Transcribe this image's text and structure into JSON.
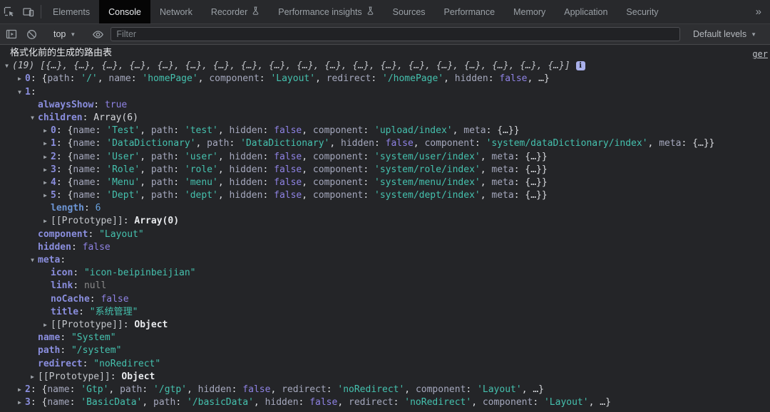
{
  "devtools": {
    "tabs": [
      {
        "label": "Elements",
        "active": false,
        "flask": false
      },
      {
        "label": "Console",
        "active": true,
        "flask": false
      },
      {
        "label": "Network",
        "active": false,
        "flask": false
      },
      {
        "label": "Recorder",
        "active": false,
        "flask": true
      },
      {
        "label": "Performance insights",
        "active": false,
        "flask": true
      },
      {
        "label": "Sources",
        "active": false,
        "flask": false
      },
      {
        "label": "Performance",
        "active": false,
        "flask": false
      },
      {
        "label": "Memory",
        "active": false,
        "flask": false
      },
      {
        "label": "Application",
        "active": false,
        "flask": false
      },
      {
        "label": "Security",
        "active": false,
        "flask": false
      }
    ],
    "more_tabs_glyph": "»"
  },
  "console_toolbar": {
    "context": "top",
    "chevron_glyph": "▼",
    "filter_placeholder": "Filter",
    "levels_label": "Default levels"
  },
  "console": {
    "source_link": "ger",
    "colors": {
      "key": "#8a8ede",
      "string": "#45c1ae",
      "boolean": "#8e82e3",
      "number": "#68a2e0",
      "null": "#8b8b8b",
      "preview": "#c0c3c8",
      "background": "#242528",
      "active_tab_bg": "#050505",
      "info_badge_bg": "#a9b0ea"
    },
    "rows": [
      {
        "lvl": "msg",
        "segs": [
          [
            "m",
            "格式化前的生成的路由表"
          ]
        ]
      },
      {
        "lvl": 0,
        "arrow": "v",
        "info": true,
        "segs": [
          [
            "i",
            "(19) [{…}, {…}, {…}, {…}, {…}, {…}, {…}, {…}, {…}, {…}, {…}, {…}, {…}, {…}, {…}, {…}, {…}, {…}, {…}]"
          ]
        ]
      },
      {
        "lvl": 1,
        "arrow": ">",
        "segs": [
          [
            "k",
            "0"
          ],
          [
            "t",
            ": {"
          ],
          [
            "p",
            "path"
          ],
          [
            "t",
            ": "
          ],
          [
            "s",
            "'/'"
          ],
          [
            "t",
            ", "
          ],
          [
            "p",
            "name"
          ],
          [
            "t",
            ": "
          ],
          [
            "s",
            "'homePage'"
          ],
          [
            "t",
            ", "
          ],
          [
            "p",
            "component"
          ],
          [
            "t",
            ": "
          ],
          [
            "s",
            "'Layout'"
          ],
          [
            "t",
            ", "
          ],
          [
            "p",
            "redirect"
          ],
          [
            "t",
            ": "
          ],
          [
            "s",
            "'/homePage'"
          ],
          [
            "t",
            ", "
          ],
          [
            "p",
            "hidden"
          ],
          [
            "t",
            ": "
          ],
          [
            "b",
            "false"
          ],
          [
            "t",
            ", …}"
          ]
        ]
      },
      {
        "lvl": 1,
        "arrow": "v",
        "segs": [
          [
            "k",
            "1"
          ],
          [
            "t",
            ":"
          ]
        ]
      },
      {
        "lvl": 2,
        "segs": [
          [
            "k",
            "alwaysShow"
          ],
          [
            "t",
            ": "
          ],
          [
            "b",
            "true"
          ]
        ]
      },
      {
        "lvl": 2,
        "arrow": "v",
        "segs": [
          [
            "k",
            "children"
          ],
          [
            "t",
            ": "
          ],
          [
            "t",
            "Array(6)"
          ]
        ]
      },
      {
        "lvl": 3,
        "arrow": ">",
        "segs": [
          [
            "k",
            "0"
          ],
          [
            "t",
            ": {"
          ],
          [
            "p",
            "name"
          ],
          [
            "t",
            ": "
          ],
          [
            "s",
            "'Test'"
          ],
          [
            "t",
            ", "
          ],
          [
            "p",
            "path"
          ],
          [
            "t",
            ": "
          ],
          [
            "s",
            "'test'"
          ],
          [
            "t",
            ", "
          ],
          [
            "p",
            "hidden"
          ],
          [
            "t",
            ": "
          ],
          [
            "b",
            "false"
          ],
          [
            "t",
            ", "
          ],
          [
            "p",
            "component"
          ],
          [
            "t",
            ": "
          ],
          [
            "s",
            "'upload/index'"
          ],
          [
            "t",
            ", "
          ],
          [
            "p",
            "meta"
          ],
          [
            "t",
            ": {…}}"
          ]
        ]
      },
      {
        "lvl": 3,
        "arrow": ">",
        "segs": [
          [
            "k",
            "1"
          ],
          [
            "t",
            ": {"
          ],
          [
            "p",
            "name"
          ],
          [
            "t",
            ": "
          ],
          [
            "s",
            "'DataDictionary'"
          ],
          [
            "t",
            ", "
          ],
          [
            "p",
            "path"
          ],
          [
            "t",
            ": "
          ],
          [
            "s",
            "'DataDictionary'"
          ],
          [
            "t",
            ", "
          ],
          [
            "p",
            "hidden"
          ],
          [
            "t",
            ": "
          ],
          [
            "b",
            "false"
          ],
          [
            "t",
            ", "
          ],
          [
            "p",
            "component"
          ],
          [
            "t",
            ": "
          ],
          [
            "s",
            "'system/dataDictionary/index'"
          ],
          [
            "t",
            ", "
          ],
          [
            "p",
            "meta"
          ],
          [
            "t",
            ": {…}}"
          ]
        ]
      },
      {
        "lvl": 3,
        "arrow": ">",
        "segs": [
          [
            "k",
            "2"
          ],
          [
            "t",
            ": {"
          ],
          [
            "p",
            "name"
          ],
          [
            "t",
            ": "
          ],
          [
            "s",
            "'User'"
          ],
          [
            "t",
            ", "
          ],
          [
            "p",
            "path"
          ],
          [
            "t",
            ": "
          ],
          [
            "s",
            "'user'"
          ],
          [
            "t",
            ", "
          ],
          [
            "p",
            "hidden"
          ],
          [
            "t",
            ": "
          ],
          [
            "b",
            "false"
          ],
          [
            "t",
            ", "
          ],
          [
            "p",
            "component"
          ],
          [
            "t",
            ": "
          ],
          [
            "s",
            "'system/user/index'"
          ],
          [
            "t",
            ", "
          ],
          [
            "p",
            "meta"
          ],
          [
            "t",
            ": {…}}"
          ]
        ]
      },
      {
        "lvl": 3,
        "arrow": ">",
        "segs": [
          [
            "k",
            "3"
          ],
          [
            "t",
            ": {"
          ],
          [
            "p",
            "name"
          ],
          [
            "t",
            ": "
          ],
          [
            "s",
            "'Role'"
          ],
          [
            "t",
            ", "
          ],
          [
            "p",
            "path"
          ],
          [
            "t",
            ": "
          ],
          [
            "s",
            "'role'"
          ],
          [
            "t",
            ", "
          ],
          [
            "p",
            "hidden"
          ],
          [
            "t",
            ": "
          ],
          [
            "b",
            "false"
          ],
          [
            "t",
            ", "
          ],
          [
            "p",
            "component"
          ],
          [
            "t",
            ": "
          ],
          [
            "s",
            "'system/role/index'"
          ],
          [
            "t",
            ", "
          ],
          [
            "p",
            "meta"
          ],
          [
            "t",
            ": {…}}"
          ]
        ]
      },
      {
        "lvl": 3,
        "arrow": ">",
        "segs": [
          [
            "k",
            "4"
          ],
          [
            "t",
            ": {"
          ],
          [
            "p",
            "name"
          ],
          [
            "t",
            ": "
          ],
          [
            "s",
            "'Menu'"
          ],
          [
            "t",
            ", "
          ],
          [
            "p",
            "path"
          ],
          [
            "t",
            ": "
          ],
          [
            "s",
            "'menu'"
          ],
          [
            "t",
            ", "
          ],
          [
            "p",
            "hidden"
          ],
          [
            "t",
            ": "
          ],
          [
            "b",
            "false"
          ],
          [
            "t",
            ", "
          ],
          [
            "p",
            "component"
          ],
          [
            "t",
            ": "
          ],
          [
            "s",
            "'system/menu/index'"
          ],
          [
            "t",
            ", "
          ],
          [
            "p",
            "meta"
          ],
          [
            "t",
            ": {…}}"
          ]
        ]
      },
      {
        "lvl": 3,
        "arrow": ">",
        "segs": [
          [
            "k",
            "5"
          ],
          [
            "t",
            ": {"
          ],
          [
            "p",
            "name"
          ],
          [
            "t",
            ": "
          ],
          [
            "s",
            "'Dept'"
          ],
          [
            "t",
            ", "
          ],
          [
            "p",
            "path"
          ],
          [
            "t",
            ": "
          ],
          [
            "s",
            "'dept'"
          ],
          [
            "t",
            ", "
          ],
          [
            "p",
            "hidden"
          ],
          [
            "t",
            ": "
          ],
          [
            "b",
            "false"
          ],
          [
            "t",
            ", "
          ],
          [
            "p",
            "component"
          ],
          [
            "t",
            ": "
          ],
          [
            "s",
            "'system/dept/index'"
          ],
          [
            "t",
            ", "
          ],
          [
            "p",
            "meta"
          ],
          [
            "t",
            ": {…}}"
          ]
        ]
      },
      {
        "lvl": 3,
        "segs": [
          [
            "d",
            "length"
          ],
          [
            "t",
            ": "
          ],
          [
            "n",
            "6"
          ]
        ]
      },
      {
        "lvl": 3,
        "arrow": ">",
        "segs": [
          [
            "o",
            "[[Prototype]]"
          ],
          [
            "t",
            ": "
          ],
          [
            "O",
            "Array(0)"
          ]
        ]
      },
      {
        "lvl": 2,
        "segs": [
          [
            "k",
            "component"
          ],
          [
            "t",
            ": "
          ],
          [
            "s",
            "\"Layout\""
          ]
        ]
      },
      {
        "lvl": 2,
        "segs": [
          [
            "k",
            "hidden"
          ],
          [
            "t",
            ": "
          ],
          [
            "b",
            "false"
          ]
        ]
      },
      {
        "lvl": 2,
        "arrow": "v",
        "segs": [
          [
            "k",
            "meta"
          ],
          [
            "t",
            ":"
          ]
        ]
      },
      {
        "lvl": 3,
        "segs": [
          [
            "k",
            "icon"
          ],
          [
            "t",
            ": "
          ],
          [
            "s",
            "\"icon-beipinbeijian\""
          ]
        ]
      },
      {
        "lvl": 3,
        "segs": [
          [
            "k",
            "link"
          ],
          [
            "t",
            ": "
          ],
          [
            "u",
            "null"
          ]
        ]
      },
      {
        "lvl": 3,
        "segs": [
          [
            "k",
            "noCache"
          ],
          [
            "t",
            ": "
          ],
          [
            "b",
            "false"
          ]
        ]
      },
      {
        "lvl": 3,
        "segs": [
          [
            "k",
            "title"
          ],
          [
            "t",
            ": "
          ],
          [
            "s",
            "\"系统管理\""
          ]
        ]
      },
      {
        "lvl": 3,
        "arrow": ">",
        "segs": [
          [
            "o",
            "[[Prototype]]"
          ],
          [
            "t",
            ": "
          ],
          [
            "O",
            "Object"
          ]
        ]
      },
      {
        "lvl": 2,
        "segs": [
          [
            "k",
            "name"
          ],
          [
            "t",
            ": "
          ],
          [
            "s",
            "\"System\""
          ]
        ]
      },
      {
        "lvl": 2,
        "segs": [
          [
            "k",
            "path"
          ],
          [
            "t",
            ": "
          ],
          [
            "s",
            "\"/system\""
          ]
        ]
      },
      {
        "lvl": 2,
        "segs": [
          [
            "k",
            "redirect"
          ],
          [
            "t",
            ": "
          ],
          [
            "s",
            "\"noRedirect\""
          ]
        ]
      },
      {
        "lvl": 2,
        "arrow": ">",
        "segs": [
          [
            "o",
            "[[Prototype]]"
          ],
          [
            "t",
            ": "
          ],
          [
            "O",
            "Object"
          ]
        ]
      },
      {
        "lvl": 1,
        "arrow": ">",
        "segs": [
          [
            "k",
            "2"
          ],
          [
            "t",
            ": {"
          ],
          [
            "p",
            "name"
          ],
          [
            "t",
            ": "
          ],
          [
            "s",
            "'Gtp'"
          ],
          [
            "t",
            ", "
          ],
          [
            "p",
            "path"
          ],
          [
            "t",
            ": "
          ],
          [
            "s",
            "'/gtp'"
          ],
          [
            "t",
            ", "
          ],
          [
            "p",
            "hidden"
          ],
          [
            "t",
            ": "
          ],
          [
            "b",
            "false"
          ],
          [
            "t",
            ", "
          ],
          [
            "p",
            "redirect"
          ],
          [
            "t",
            ": "
          ],
          [
            "s",
            "'noRedirect'"
          ],
          [
            "t",
            ", "
          ],
          [
            "p",
            "component"
          ],
          [
            "t",
            ": "
          ],
          [
            "s",
            "'Layout'"
          ],
          [
            "t",
            ", …}"
          ]
        ]
      },
      {
        "lvl": 1,
        "arrow": ">",
        "segs": [
          [
            "k",
            "3"
          ],
          [
            "t",
            ": {"
          ],
          [
            "p",
            "name"
          ],
          [
            "t",
            ": "
          ],
          [
            "s",
            "'BasicData'"
          ],
          [
            "t",
            ", "
          ],
          [
            "p",
            "path"
          ],
          [
            "t",
            ": "
          ],
          [
            "s",
            "'/basicData'"
          ],
          [
            "t",
            ", "
          ],
          [
            "p",
            "hidden"
          ],
          [
            "t",
            ": "
          ],
          [
            "b",
            "false"
          ],
          [
            "t",
            ", "
          ],
          [
            "p",
            "redirect"
          ],
          [
            "t",
            ": "
          ],
          [
            "s",
            "'noRedirect'"
          ],
          [
            "t",
            ", "
          ],
          [
            "p",
            "component"
          ],
          [
            "t",
            ": "
          ],
          [
            "s",
            "'Layout'"
          ],
          [
            "t",
            ", …}"
          ]
        ]
      }
    ]
  }
}
